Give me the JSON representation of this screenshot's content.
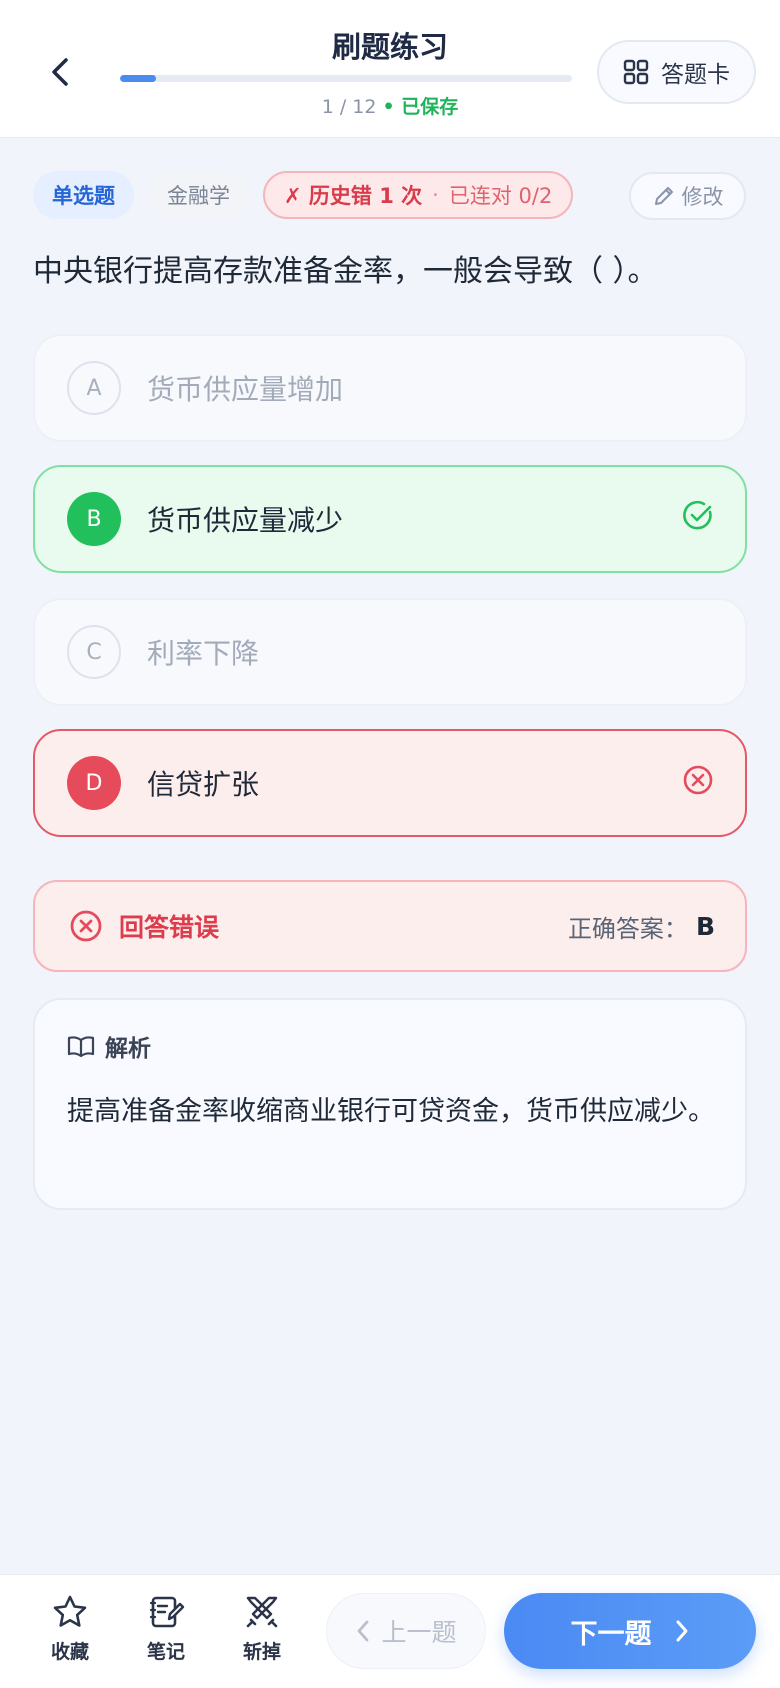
{
  "header": {
    "title": "刷题练习",
    "progress": {
      "current": 1,
      "total": 12,
      "separator": "/",
      "saved_label": "• 已保存",
      "fraction": 0.08
    },
    "answer_card_label": "答题卡",
    "back_icon": "chevron-left-icon",
    "answer_card_icon": "grid-icon"
  },
  "tags": {
    "type": "单选题",
    "subject": "金融学",
    "history_error": "✗ 历史错 1 次",
    "history_dot": "·",
    "history_streak": "已连对 0/2"
  },
  "edit_label": "修改",
  "question": "中央银行提高存款准备金率，一般会导致（ ）。",
  "options": [
    {
      "letter": "A",
      "text": "货币供应量增加",
      "state": "neutral"
    },
    {
      "letter": "B",
      "text": "货币供应量减少",
      "state": "correct"
    },
    {
      "letter": "C",
      "text": "利率下降",
      "state": "neutral"
    },
    {
      "letter": "D",
      "text": "信贷扩张",
      "state": "wrong"
    }
  ],
  "result": {
    "label": "回答错误",
    "correct_answer_label": "正确答案：",
    "correct_answer": "B"
  },
  "analysis": {
    "title": "解析",
    "body": "提高准备金率收缩商业银行可贷资金，货币供应减少。"
  },
  "bottom": {
    "favorite": "收藏",
    "notes": "笔记",
    "remove": "斩掉",
    "prev": "上一题",
    "next": "下一题"
  },
  "colors": {
    "accent": "#4a8bf0",
    "correct": "#22c05c",
    "wrong": "#e64b5b",
    "saved": "#1fb35a"
  }
}
